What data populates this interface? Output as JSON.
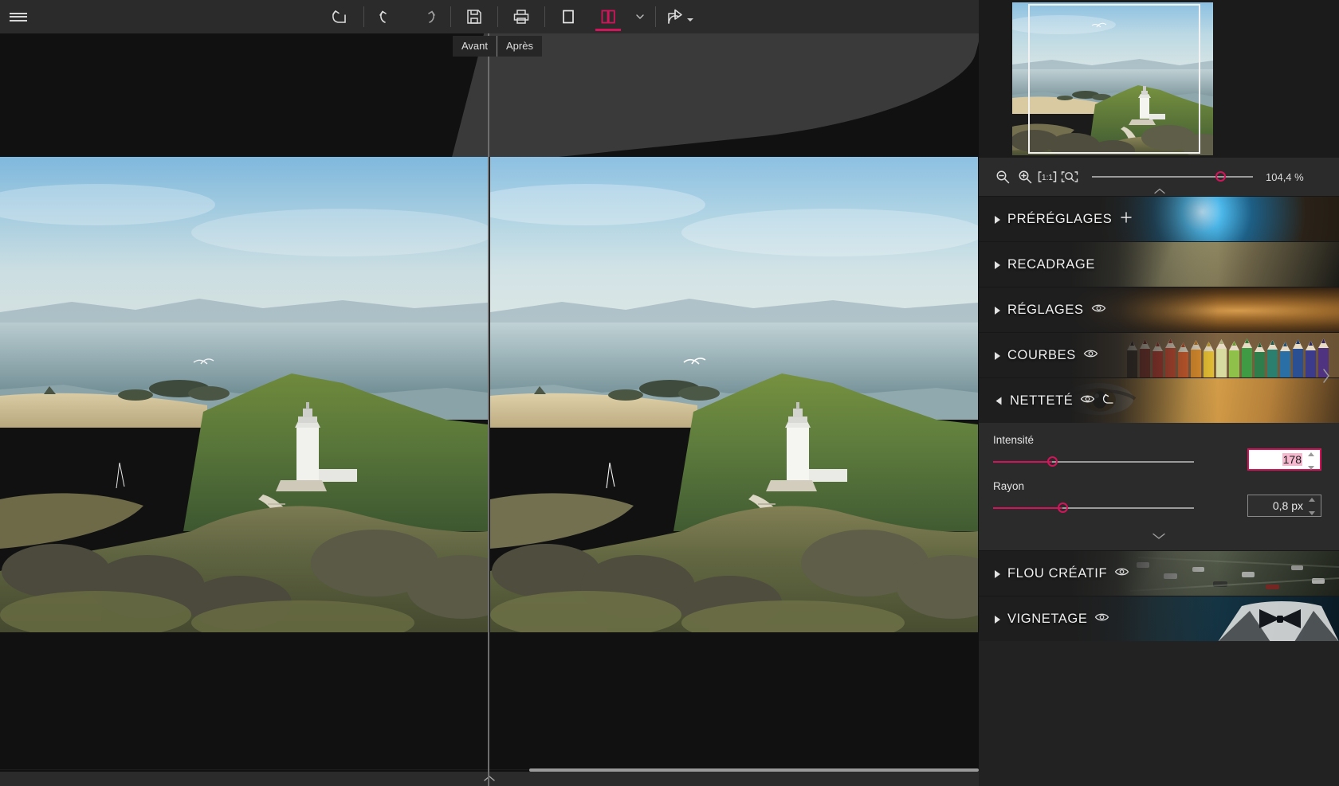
{
  "app": {
    "accent_color": "#d4145a",
    "toolbar_bg": "#2b2b2b",
    "canvas_bg": "#111111",
    "sidebar_bg": "#222222"
  },
  "toolbar": {
    "menu_label": "menu",
    "buttons": [
      {
        "name": "reset-all",
        "icon": "reset-arrow-icon",
        "active": false
      },
      {
        "name": "undo",
        "icon": "undo-icon",
        "active": false
      },
      {
        "name": "redo",
        "icon": "redo-icon",
        "active": false
      },
      {
        "name": "save",
        "icon": "save-floppy-icon",
        "active": false
      },
      {
        "name": "print",
        "icon": "printer-icon",
        "active": false
      },
      {
        "name": "single-view",
        "icon": "single-pane-icon",
        "active": false
      },
      {
        "name": "split-view",
        "icon": "split-pane-icon",
        "active": true
      },
      {
        "name": "view-options",
        "icon": "chevron-down-icon",
        "active": false
      },
      {
        "name": "share",
        "icon": "share-export-icon",
        "active": false
      }
    ]
  },
  "canvas": {
    "tabs": [
      {
        "label": "Avant",
        "selected": false
      },
      {
        "label": "Après",
        "selected": true
      }
    ],
    "scroll_thumb_label": "horizontal-scrollbar",
    "collapse_label": "collapse-filmstrip"
  },
  "navigator": {
    "label": "image-navigator",
    "viewport_label": "navigator-viewport"
  },
  "zoombar": {
    "zoom_out_icon": "zoom-out-icon",
    "zoom_in_icon": "zoom-in-icon",
    "actual_size_icon": "one-to-one-icon",
    "fit_screen_icon": "fit-to-screen-icon",
    "slider_label": "zoom-slider",
    "percent": "104,4 %",
    "collapse_label": "collapse-zoombar"
  },
  "sections": [
    {
      "id": "presets",
      "title": "PRÉRÉGLAGES",
      "expanded": false,
      "has_eye": false,
      "has_reset": false,
      "has_plus": true,
      "thumb_css": "radial-gradient(circle at 62% 34%, #bfe9ff 0%, #4bb6e8 9%, #1d5f86 22%, #2a2218 46%, #15100a 100%)"
    },
    {
      "id": "crop",
      "title": "RECADRAGE",
      "expanded": false,
      "has_eye": false,
      "has_reset": false,
      "has_plus": false,
      "thumb_css": "linear-gradient(110deg, #2b2b25 0%, #6e6b4e 30%, #b5ae7d 52%, #6a6146 74%, #1a1a16 100%)"
    },
    {
      "id": "adjustments",
      "title": "RÉGLAGES",
      "expanded": false,
      "has_eye": true,
      "has_reset": false,
      "has_plus": false,
      "thumb_css": "radial-gradient(ellipse at 72% 52%, #d59a4c 0%, #9d6a2c 24%, #5c3d1a 52%, #241810 82%, #120c08 100%)"
    },
    {
      "id": "curves",
      "title": "COURBES",
      "expanded": false,
      "has_eye": true,
      "has_reset": false,
      "has_plus": false,
      "thumb_css": "linear-gradient(90deg, #6d5236 0%, #7d6242 22%, #8a6d4a 45%, #7b6140 70%, #6a5234 100%)"
    },
    {
      "id": "sharpen",
      "title": "NETTETÉ",
      "expanded": true,
      "has_eye": true,
      "has_reset": true,
      "has_plus": false,
      "thumb_css": "linear-gradient(100deg, #2a2018 0%, #5c4126 16%, #c08c3e 38%, #e0a94e 58%, #b5803a 80%, #4e381f 100%)"
    },
    {
      "id": "creative-blur",
      "title": "FLOU CRÉATIF",
      "expanded": false,
      "has_eye": true,
      "has_reset": false,
      "has_plus": false,
      "thumb_css": "linear-gradient(120deg, #23281f 0%, #4a5340 26%, #6d7560 48%, #41483a 72%, #1d211a 100%)"
    },
    {
      "id": "vignette",
      "title": "VIGNETAGE",
      "expanded": false,
      "has_eye": true,
      "has_reset": false,
      "has_plus": false,
      "thumb_css": "linear-gradient(100deg, #0d1f2a 0%, #16323f 26%, #1d4251 46%, #123040 70%, #0a1a24 100%)"
    }
  ],
  "sharpen_panel": {
    "sliders": [
      {
        "label": "Intensité",
        "value_text": "178",
        "fill_percent": 29,
        "focused": true
      },
      {
        "label": "Rayon",
        "value_text": "0,8 px",
        "fill_percent": 34,
        "focused": false
      }
    ],
    "collapse_label": "collapse-sharpen-panel"
  },
  "panel_collapse": {
    "label": "collapse-right-panel",
    "icon": "chevron-right-icon"
  }
}
